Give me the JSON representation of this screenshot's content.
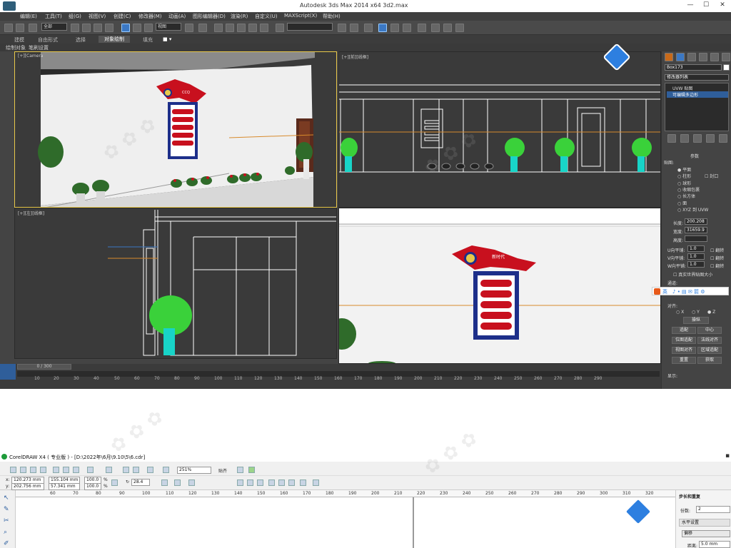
{
  "max": {
    "app_title": "Autodesk 3ds Max  2014 x64     3d2.max",
    "menu": [
      "编辑(E)",
      "工具(T)",
      "组(G)",
      "视图(V)",
      "创建(C)",
      "修改器(M)",
      "动画(A)",
      "图形编辑器(D)",
      "渲染(R)",
      "自定义(U)",
      "MAXScript(X)",
      "帮助(H)"
    ],
    "selection_filter": "全部",
    "view_dropdown": "视图",
    "named_selection": "",
    "ribbon_tabs": [
      "建模",
      "自由形式",
      "选择",
      "对象绘制",
      "填充"
    ],
    "active_ribbon_tab": "对象绘制",
    "sub_tabs": [
      "绘制对象",
      "笔刷设置"
    ],
    "viewports": {
      "camera": "[+][Camera",
      "front": "[+][前][线框]",
      "top": "[+][左][线框]",
      "persp": ""
    },
    "right_panel": {
      "object_name": "Box173",
      "modifier_list": "修改器列表",
      "stack": [
        "UVW 贴图",
        "可编辑多边形"
      ],
      "section_params": "参数",
      "mapping_label": "贴图:",
      "mapping_options": [
        "平面",
        "柱形",
        "球形",
        "收缩包裹",
        "长方体",
        "面",
        "XYZ 到 UVW"
      ],
      "cap_label": "封口",
      "length_label": "长度:",
      "length_value": "200.208",
      "width_label": "宽度:",
      "width_value": "31659.9",
      "height_label": "高度:",
      "u_tile_label": "U向平铺:",
      "u_tile": "1.0",
      "v_tile_label": "V向平铺:",
      "v_tile": "1.0",
      "w_tile_label": "W向平铺:",
      "w_tile": "1.0",
      "flip_label": "翻转",
      "real_world": "真实世界贴图大小",
      "channel_label": "通道:",
      "alignment_label": "对齐:",
      "align_axes": [
        "X",
        "Y",
        "Z"
      ],
      "buttons": [
        "操纵",
        "适配",
        "中心",
        "位图适配",
        "法线对齐",
        "视图对齐",
        "区域适配",
        "重置",
        "获取"
      ],
      "display_label": "显示:"
    },
    "ime_toolbar": "英",
    "timeline": "0 / 300",
    "ruler_ticks": [
      "0",
      "10",
      "20",
      "30",
      "40",
      "50",
      "60",
      "70",
      "80",
      "90",
      "100",
      "110",
      "120",
      "130",
      "140",
      "150",
      "160",
      "170",
      "180",
      "190",
      "200",
      "210",
      "220",
      "230",
      "240",
      "250",
      "260",
      "270",
      "280",
      "290"
    ],
    "sign_heading": "CCQ",
    "sign_heading2": "新时代"
  },
  "corel": {
    "app_title": "CorelDRAW X4 ( 专业版 ) - [D:\\2022年\\6月\\9.10\\5\\6.cdr]",
    "zoom": "251%",
    "snap_label": "贴齐",
    "x_label": "x:",
    "x_value": "120.273 mm",
    "y_label": "y:",
    "y_value": "202.756 mm",
    "w_value": "155.104 mm",
    "h_value": "57.341 mm",
    "scale_x": "100.0",
    "scale_y": "100.0",
    "pct": "%",
    "angle": "28.4",
    "ruler_ticks": [
      "60",
      "70",
      "80",
      "90",
      "100",
      "110",
      "120",
      "130",
      "140",
      "150",
      "160",
      "170",
      "180",
      "190",
      "200",
      "210",
      "220",
      "230",
      "240",
      "250",
      "260",
      "270",
      "280",
      "290",
      "300",
      "310",
      "320"
    ],
    "docker_title": "步长和重复",
    "copies_label": "份数:",
    "copies_value": "2",
    "horizontal_label": "水平设置",
    "offset_label": "偏移",
    "distance_label": "距离:",
    "distance_value": "5.0 mm"
  },
  "colors": {
    "max_bg": "#444444",
    "viewport_bg": "#3a3a3a",
    "active_border": "#e8c84a",
    "sign_red": "#c8101e",
    "sign_blue": "#1d2f8a",
    "plant_green": "#3ad13a",
    "pot_cyan": "#18d4c8"
  }
}
